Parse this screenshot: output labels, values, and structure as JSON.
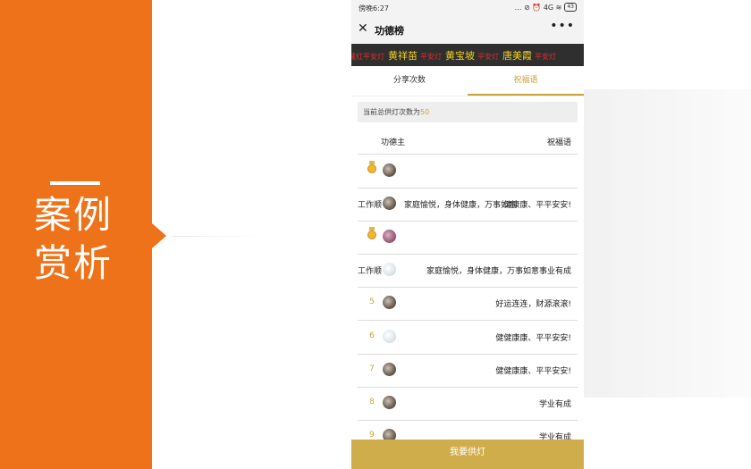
{
  "slide": {
    "title_line1": "案例",
    "title_line2": "赏析"
  },
  "status_bar": {
    "time": "傍晚6:27",
    "icons": "… ⊘ ⏰ 4G ≋",
    "battery": "43"
  },
  "nav": {
    "title": "功德榜",
    "close_icon": "✕",
    "more_icon": "•••"
  },
  "marquee": {
    "items": [
      {
        "name": "",
        "action": "藏红平安灯"
      },
      {
        "name": "黄祥苗",
        "action": "平安灯"
      },
      {
        "name": "黄宝坡",
        "action": "平安灯"
      },
      {
        "name": "唐美霞",
        "action": "平安灯"
      }
    ]
  },
  "tabs": [
    {
      "label": "分享次数",
      "active": false
    },
    {
      "label": "祝福语",
      "active": true
    }
  ],
  "summary": {
    "label": "当前总供灯次数为",
    "value": "50"
  },
  "table": {
    "col_donor": "功德主",
    "col_blessing": "祝福语",
    "rows": [
      {
        "rank": "",
        "medal": true,
        "avatar": "av1",
        "blessing": "",
        "overlay_left": "",
        "overlay_mid": ""
      },
      {
        "rank": "",
        "medal": false,
        "avatar": "av1",
        "blessing": "健康康、平平安安!",
        "overlay_left": "工作顺",
        "overlay_mid": "家庭愉悦，身体健康，万事如意"
      },
      {
        "rank": "",
        "medal": true,
        "avatar": "av2",
        "blessing": "",
        "overlay_left": "",
        "overlay_mid": ""
      },
      {
        "rank": "",
        "medal": false,
        "avatar": "av3",
        "blessing": "家庭愉悦，身体健康，万事如意事业有成",
        "overlay_left": "工作顺",
        "overlay_mid": ""
      },
      {
        "rank": "5",
        "medal": false,
        "avatar": "av1",
        "blessing": "好运连连，财源滚滚!",
        "overlay_left": "",
        "overlay_mid": ""
      },
      {
        "rank": "6",
        "medal": false,
        "avatar": "av3",
        "blessing": "健健康康、平平安安!",
        "overlay_left": "",
        "overlay_mid": ""
      },
      {
        "rank": "7",
        "medal": false,
        "avatar": "av1",
        "blessing": "健健康康、平平安安!",
        "overlay_left": "",
        "overlay_mid": ""
      },
      {
        "rank": "8",
        "medal": false,
        "avatar": "av1",
        "blessing": "学业有成",
        "overlay_left": "",
        "overlay_mid": ""
      },
      {
        "rank": "9",
        "medal": false,
        "avatar": "av1",
        "blessing": "学业有成",
        "overlay_left": "",
        "overlay_mid": ""
      }
    ]
  },
  "cta": {
    "label": "我要供灯"
  },
  "colors": {
    "accent_orange": "#ee7219",
    "gold": "#c9a43a",
    "button_gold": "#d0ad4b",
    "marquee_name": "#f1d21e",
    "marquee_action": "#e62b2b"
  }
}
